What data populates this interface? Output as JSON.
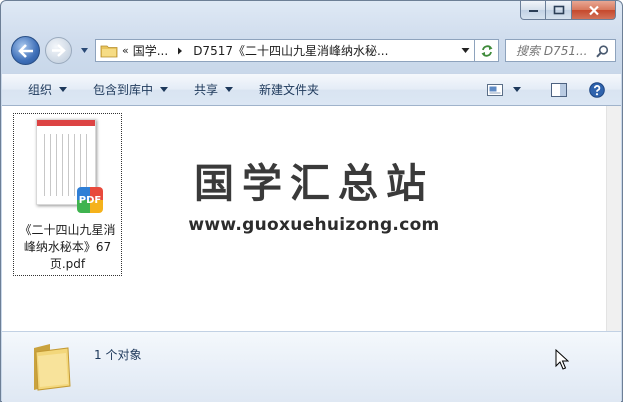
{
  "window": {
    "caption_buttons": {
      "minimize": "minimize",
      "maximize": "maximize",
      "close": "close"
    }
  },
  "nav": {
    "address": {
      "overflow_marker": "«",
      "crumbs": [
        "国学...",
        "D7517《二十四山九星消峰纳水秘..."
      ]
    },
    "search": {
      "placeholder": "搜索 D751..."
    }
  },
  "toolbar": {
    "organize": "组织",
    "include_in_library": "包含到库中",
    "share": "共享",
    "new_folder": "新建文件夹"
  },
  "content": {
    "file": {
      "name": "《二十四山九星消峰纳水秘本》67页.pdf",
      "badge": "PDF"
    },
    "watermark": {
      "title": "国学汇总站",
      "url": "www.guoxuehuizong.com"
    }
  },
  "details": {
    "count_text": "1 个对象"
  },
  "colors": {
    "accent": "#1e395b",
    "window_frame": "#cfdced",
    "close_button": "#c5482c"
  }
}
